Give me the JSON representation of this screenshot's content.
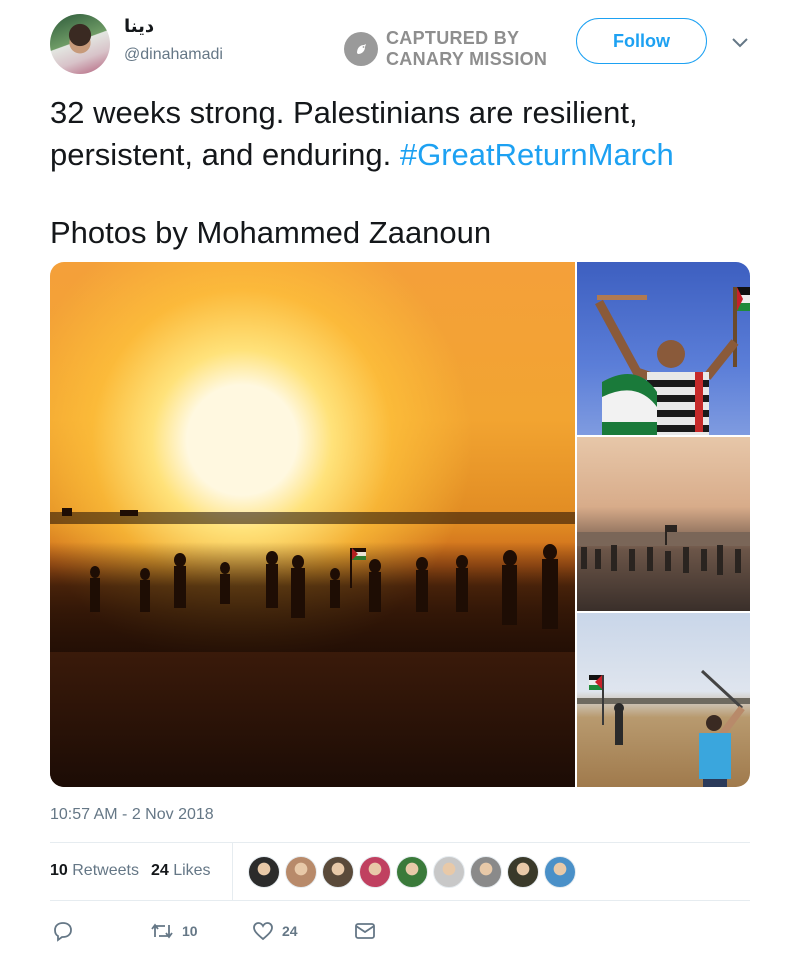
{
  "tweet": {
    "display_name": "دينا",
    "handle": "@dinahamadi",
    "follow_label": "Follow",
    "text": "32 weeks strong. Palestinians are resilient, persistent, and enduring. ",
    "hashtag": "#GreatReturnMarch",
    "photo_credit": "Photos by Mohammed Zaanoun",
    "timestamp": "10:57 AM - 2 Nov 2018"
  },
  "watermark": {
    "line1": "CAPTURED BY",
    "line2": "CANARY MISSION"
  },
  "stats": {
    "retweets_count": "10",
    "retweets_label": "Retweets",
    "likes_count": "24",
    "likes_label": "Likes"
  },
  "actions": {
    "retweet_count": "10",
    "like_count": "24"
  },
  "likers": [
    {
      "color": "#2b2b2b"
    },
    {
      "color": "#b88a6a"
    },
    {
      "color": "#5a4a3a"
    },
    {
      "color": "#c04060"
    },
    {
      "color": "#3a7a3a"
    },
    {
      "color": "#c8c8c8"
    },
    {
      "color": "#8a8a8a"
    },
    {
      "color": "#3a3a2a"
    },
    {
      "color": "#4a90c8"
    }
  ],
  "colors": {
    "accent": "#1da1f2",
    "muted": "#657786",
    "text": "#14171a"
  }
}
